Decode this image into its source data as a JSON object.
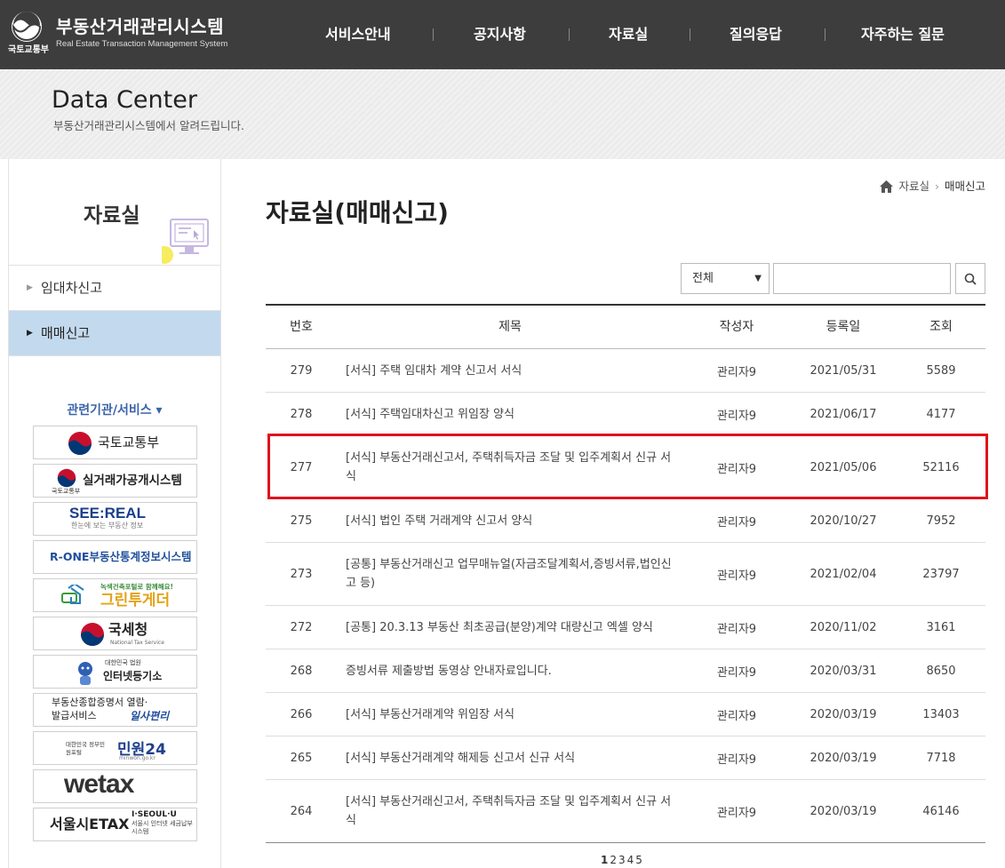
{
  "header": {
    "ministry": "국토교통부",
    "system_title": "부동산거래관리시스템",
    "system_subtitle": "Real Estate Transaction Management System",
    "nav": [
      "서비스안내",
      "공지사항",
      "자료실",
      "질의응답",
      "자주하는 질문"
    ]
  },
  "banner": {
    "title": "Data Center",
    "description": "부동산거래관리시스템에서 알려드립니다."
  },
  "sidebar": {
    "title": "자료실",
    "menu": [
      {
        "label": "임대차신고",
        "active": false
      },
      {
        "label": "매매신고",
        "active": true
      }
    ],
    "related_title": "관련기관/서비스 ▾",
    "related": [
      "국토교통부",
      "실거래가공개시스템",
      "SEE:REAL",
      "R-ONE부동산통계정보시스템",
      "그린투게더",
      "국세청",
      "인터넷등기소",
      "부동산종합증명서 열람·발급서비스",
      "민원24",
      "wetax",
      "서울시ETAX"
    ],
    "related_sub": {
      "see_real": "한눈에 보는 부동산 정보",
      "green": "녹색건축포털로 함께해요!",
      "green_ministry": "대한민국 법원",
      "nts": "National Tax Service",
      "ilsa": "일사편리",
      "minwon_gov": "대한민국 정부민원포털",
      "minwon_url": "minwon.go.kr",
      "seoul_brand": "I·SEOUL·U",
      "seoul_desc": "서울시 인터넷 세금납부 시스템",
      "molit_small": "국토교통부"
    }
  },
  "breadcrumb": [
    "자료실",
    "매매신고"
  ],
  "page_title": "자료실(매매신고)",
  "search": {
    "select_value": "전체",
    "input_value": ""
  },
  "table": {
    "headers": [
      "번호",
      "제목",
      "작성자",
      "등록일",
      "조회"
    ],
    "rows": [
      {
        "no": "279",
        "title": "[서식] 주택 임대차 계약 신고서 서식",
        "author": "관리자9",
        "date": "2021/05/31",
        "views": "5589"
      },
      {
        "no": "278",
        "title": "[서식] 주택임대차신고 위임장 양식",
        "author": "관리자9",
        "date": "2021/06/17",
        "views": "4177"
      },
      {
        "no": "277",
        "title": "[서식] 부동산거래신고서, 주택취득자금 조달 및 입주계획서 신규 서식",
        "author": "관리자9",
        "date": "2021/05/06",
        "views": "52116"
      },
      {
        "no": "275",
        "title": "[서식] 법인 주택 거래계약 신고서 양식",
        "author": "관리자9",
        "date": "2020/10/27",
        "views": "7952"
      },
      {
        "no": "273",
        "title": "[공통] 부동산거래신고 업무매뉴얼(자금조달계획서,증빙서류,법인신고 등)",
        "author": "관리자9",
        "date": "2021/02/04",
        "views": "23797"
      },
      {
        "no": "272",
        "title": "[공통] 20.3.13 부동산 최초공급(분양)계약 대량신고 엑셀 양식",
        "author": "관리자9",
        "date": "2020/11/02",
        "views": "3161"
      },
      {
        "no": "268",
        "title": "증빙서류 제출방법 동영상 안내자료입니다.",
        "author": "관리자9",
        "date": "2020/03/31",
        "views": "8650"
      },
      {
        "no": "266",
        "title": "[서식] 부동산거래계약 위임장 서식",
        "author": "관리자9",
        "date": "2020/03/19",
        "views": "13403"
      },
      {
        "no": "265",
        "title": "[서식] 부동산거래계약 해제등 신고서 신규 서식",
        "author": "관리자9",
        "date": "2020/03/19",
        "views": "7718"
      },
      {
        "no": "264",
        "title": "[서식] 부동산거래신고서, 주택취득자금 조달 및 입주계획서 신규 서식",
        "author": "관리자9",
        "date": "2020/03/19",
        "views": "46146"
      }
    ]
  },
  "pagination": {
    "pages": [
      "1",
      "2",
      "3",
      "4",
      "5"
    ],
    "current": "1"
  },
  "colors": {
    "topbar": "#3d3d3d",
    "active_menu": "#c3d9ee",
    "highlight": "#e0121b",
    "link_blue": "#3b64a8"
  }
}
